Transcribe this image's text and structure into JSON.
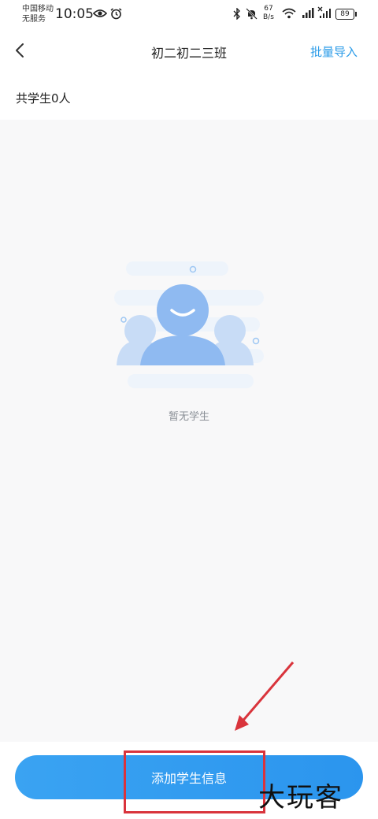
{
  "status_bar": {
    "carrier_line1": "中国移动",
    "carrier_line2": "无服务",
    "time": "10:05",
    "speed_value": "67",
    "speed_unit": "B/s",
    "battery": "89"
  },
  "header": {
    "title": "初二初二三班",
    "right_action": "批量导入"
  },
  "student_count_label": "共学生0人",
  "empty_state": {
    "text": "暂无学生"
  },
  "primary_button": "添加学生信息",
  "watermark": "大玩客",
  "colors": {
    "accent": "#2a9be8",
    "button": "#2b95ee",
    "annotation": "#d9343c",
    "background": "#f8f8f9"
  }
}
